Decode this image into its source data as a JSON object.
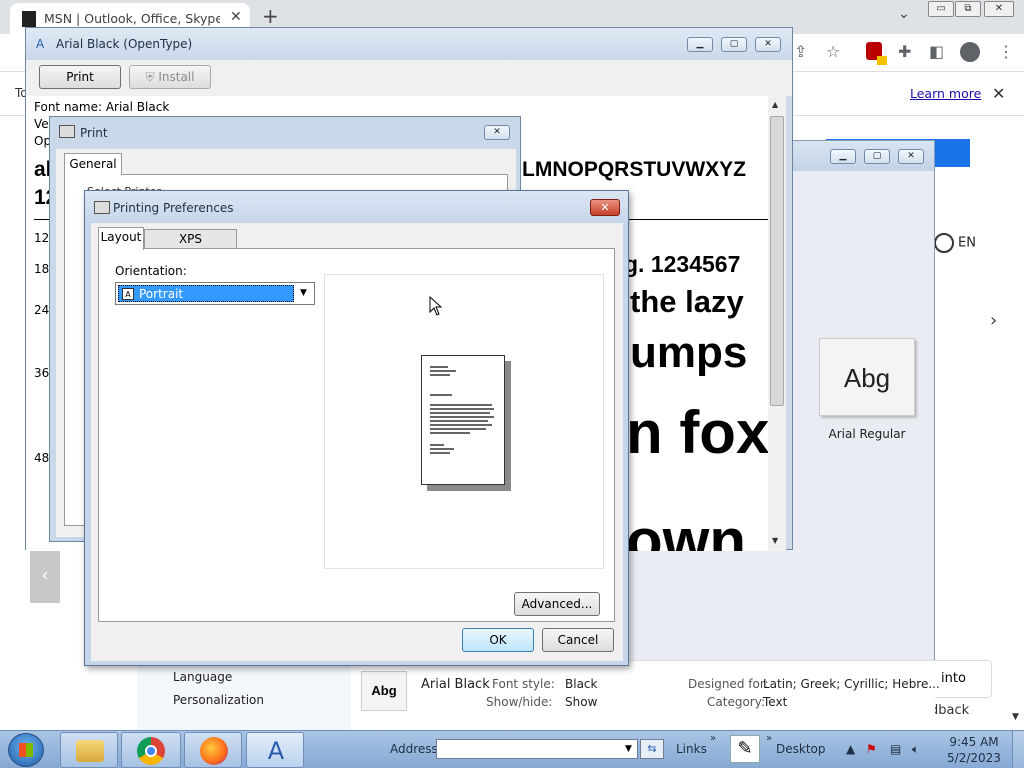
{
  "browser": {
    "tab_title": "MSN | Outlook, Office, Skype, Bi",
    "tab_close": "✕",
    "new_tab": "+",
    "tab_chevron": "⌄",
    "win_min": "▭",
    "win_max": "⧉",
    "win_close": "✕",
    "infobar_prefix": "To",
    "learn_more": "Learn more",
    "infobar_close": "✕",
    "language": "EN",
    "icons": [
      "back-arrow-icon",
      "share-icon",
      "star-icon",
      "extension-shield-icon",
      "puzzle-icon",
      "sidebar-icon",
      "profile-icon",
      "menu-dots-icon"
    ],
    "into_button": "into",
    "feedback": "dback"
  },
  "fonts_window": {
    "tile_sample": "Abg",
    "tile_name": "Arial Regular",
    "more": "⋯",
    "sidebar_items": [
      "Language",
      "Personalization"
    ],
    "details": {
      "thumb": "Abg",
      "name": "Arial Black",
      "font_style_label": "Font style:",
      "font_style": "Black",
      "show_hide_label": "Show/hide:",
      "show_hide": "Show",
      "designed_for_label": "Designed for:",
      "designed_for": "Latin; Greek; Cyrillic; Hebre...",
      "category_label": "Category:",
      "category": "Text"
    }
  },
  "font_viewer": {
    "title": "Arial Black (OpenType)",
    "print_label": "Print",
    "install_label": "Install",
    "font_name": "Font name: Arial Black",
    "version_prefix": "Ve",
    "opentype_prefix": "Op",
    "alphabet_lower_prefix": "al",
    "alphabet_upper_tail": "LMNOPQRSTUVWXYZ",
    "digits_prefix": "12",
    "sizes": [
      "12",
      "18",
      "24",
      "36",
      "48"
    ],
    "sample_12": "g. 1234567",
    "sample_18": "the lazy",
    "sample_24": "umps",
    "sample_36": "n fox",
    "sample_48": "own"
  },
  "print_dialog": {
    "title": "Print",
    "close": "✕",
    "tab_general": "General",
    "select_printer_partial": "Select Printer"
  },
  "printing_preferences": {
    "title": "Printing Preferences",
    "close": "✕",
    "tabs": [
      "Layout",
      "XPS Documents"
    ],
    "active_tab": "Layout",
    "orientation_label": "Orientation:",
    "orientation_value": "Portrait",
    "orientation_icon": "A",
    "advanced_label": "Advanced...",
    "ok_label": "OK",
    "cancel_label": "Cancel"
  },
  "taskbar": {
    "address_label": "Address",
    "links_label": "Links",
    "desktop_label": "Desktop",
    "time": "9:45 AM",
    "date": "5/2/2023",
    "apps": [
      "file-explorer-icon",
      "chrome-icon",
      "firefox-icon",
      "font-viewer-icon"
    ]
  }
}
